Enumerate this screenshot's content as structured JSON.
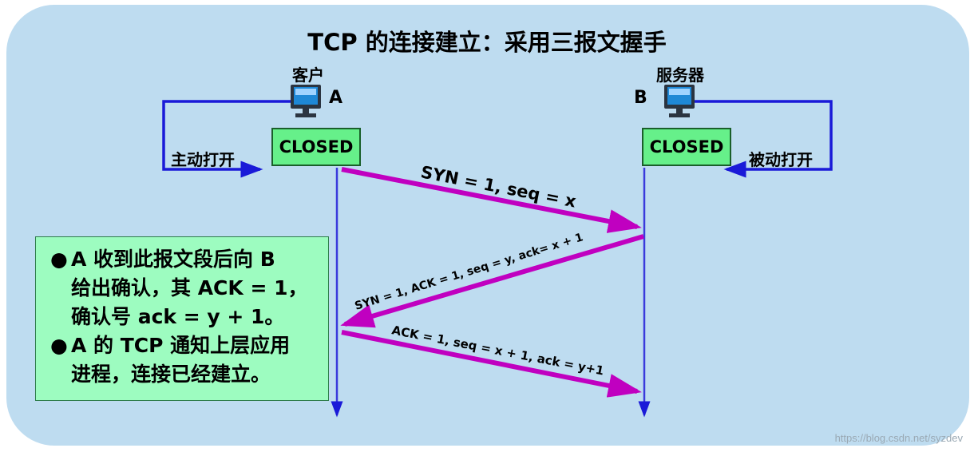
{
  "title": "TCP 的连接建立：采用三报文握手",
  "client": {
    "caption": "客户",
    "id": "A",
    "state": "CLOSED",
    "open_label": "主动打开",
    "icon": "computer-icon"
  },
  "server": {
    "caption": "服务器",
    "id": "B",
    "state": "CLOSED",
    "open_label": "被动打开",
    "icon": "computer-icon"
  },
  "messages": [
    {
      "label": "SYN = 1, seq = x"
    },
    {
      "label": "SYN = 1, ACK = 1, seq = y, ack= x + 1"
    },
    {
      "label": "ACK = 1, seq = x + 1, ack = y+1"
    }
  ],
  "note": {
    "bullet": "●",
    "items": [
      {
        "lines": [
          "A 收到此报文段后向 B",
          "给出确认，其 ACK = 1，",
          "确认号 ack = y + 1。"
        ]
      },
      {
        "lines": [
          "A 的 TCP 通知上层应用",
          "进程，连接已经建立。"
        ]
      }
    ]
  },
  "watermark": "https://blog.csdn.net/syzdev",
  "colors": {
    "background": "#bedcf0",
    "state_fill": "#66f08a",
    "note_fill": "#9dfcc0",
    "message_arrow": "#c000c0",
    "timeline": "#3a3adc",
    "open_arrow": "#1a1ad8"
  }
}
